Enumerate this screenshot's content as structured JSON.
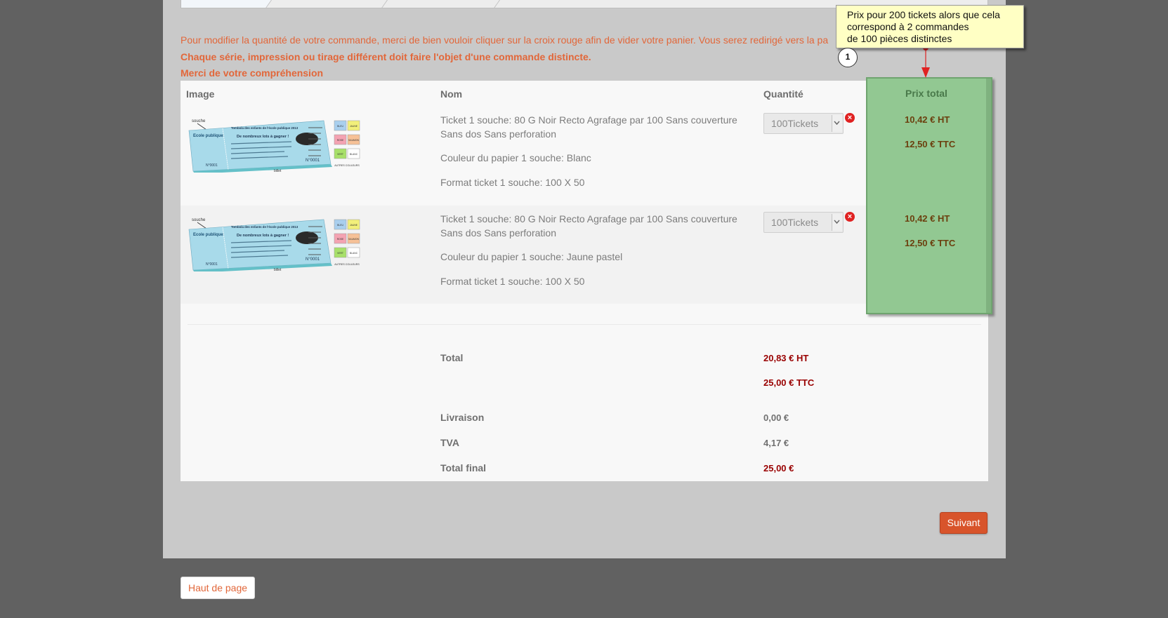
{
  "notices": {
    "line1": "Pour modifier la quantité de votre commande, merci de bien vouloir cliquer sur la croix rouge afin de vider votre panier. Vous serez redirigé vers la pa",
    "line2": "Chaque série, impression ou tirage différent doit faire l'objet d'une commande distincte.",
    "line3": "Merci de votre compréhension"
  },
  "table": {
    "headers": {
      "image": "Image",
      "name": "Nom",
      "quantity": "Quantité",
      "total_price": "Prix total"
    },
    "rows": [
      {
        "name_line1": "Ticket 1 souche: 80 G Noir Recto Agrafage par 100 Sans couverture",
        "name_line2": "Sans dos Sans perforation",
        "color": "Couleur du papier 1 souche: Blanc",
        "format": "Format ticket 1 souche: 100 X 50",
        "quantity": "100Tickets",
        "price_ht": "10,42 € HT",
        "price_ttc": "12,50 € TTC"
      },
      {
        "name_line1": "Ticket 1 souche: 80 G Noir Recto Agrafage par 100 Sans couverture",
        "name_line2": "Sans dos Sans perforation",
        "color": "Couleur du papier 1 souche: Jaune pastel",
        "format": "Format ticket 1 souche: 100 X 50",
        "quantity": "100Tickets",
        "price_ht": "10,42 € HT",
        "price_ttc": "12,50 € TTC"
      }
    ]
  },
  "ticket_image": {
    "stub_label": "souche",
    "ticket_label": "billet",
    "school": "Ecole publique",
    "heading": "Tombola des enfants de l'école publique 2013",
    "subheading": "De nombreux lots à gagner !",
    "number": "N°0001",
    "swatches": [
      "BLEU",
      "JAUNE",
      "ROSE",
      "SAUMON",
      "VERT",
      "BLANC"
    ],
    "footer": "AUTRES COULEURS"
  },
  "totals": {
    "total_label": "Total",
    "total_ht": "20,83 € HT",
    "total_ttc": "25,00 € TTC",
    "shipping_label": "Livraison",
    "shipping_value": "0,00 €",
    "vat_label": "TVA",
    "vat_value": "4,17 €",
    "final_label": "Total final",
    "final_value": "25,00 €"
  },
  "buttons": {
    "next": "Suivant",
    "back_to_top": "Haut de page"
  },
  "annotation": {
    "line1": "Prix pour 200 tickets alors que cela",
    "line2": "correspond à 2 commandes",
    "line3": "de 100 pièces distinctes",
    "badge": "1"
  },
  "colors": {
    "page_bg": "#616161",
    "panel_bg": "#c9c9c9",
    "notice_orange": "#e2673a",
    "price_highlight": "#92c892",
    "total_red": "#990000",
    "button_orange": "#d8542b",
    "callout_yellow": "#ffffc4",
    "remove_red": "#e02222"
  },
  "icons": {
    "remove": "remove-icon",
    "dropdown": "chevron-down-icon",
    "connector": "arrow-down-icon"
  }
}
